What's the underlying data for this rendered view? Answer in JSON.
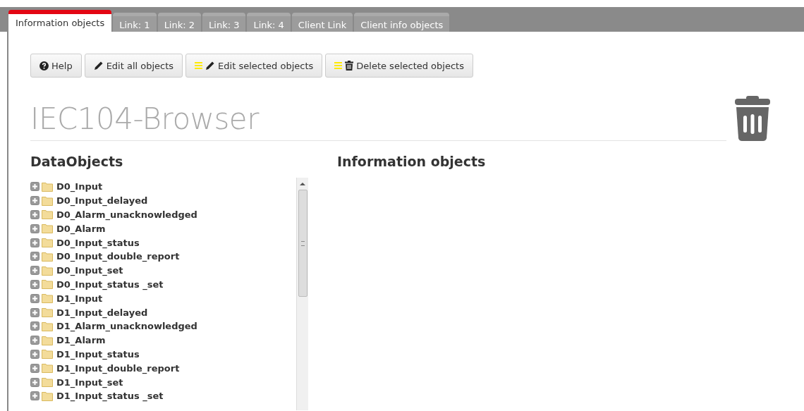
{
  "tabs": [
    {
      "label": "Information objects",
      "selected": true
    },
    {
      "label": "Link: 1",
      "selected": false
    },
    {
      "label": "Link: 2",
      "selected": false
    },
    {
      "label": "Link: 3",
      "selected": false
    },
    {
      "label": "Link: 4",
      "selected": false
    },
    {
      "label": "Client Link",
      "selected": false
    },
    {
      "label": "Client info objects",
      "selected": false
    }
  ],
  "toolbar": [
    {
      "label": "Help",
      "kind": "help"
    },
    {
      "label": "Edit all objects",
      "kind": "edit"
    },
    {
      "label": "Edit selected objects",
      "kind": "edit-selected"
    },
    {
      "label": "Delete selected objects",
      "kind": "delete-selected"
    }
  ],
  "page_title": "IEC104-Browser",
  "tree": {
    "heading": "DataObjects",
    "items": [
      {
        "label": "D0_Input",
        "expanded": false
      },
      {
        "label": "D0_Input_delayed",
        "expanded": false
      },
      {
        "label": "D0_Alarm_unacknowledged",
        "expanded": false
      },
      {
        "label": "D0_Alarm",
        "expanded": false
      },
      {
        "label": "D0_Input_status",
        "expanded": false
      },
      {
        "label": "D0_Input_double_report",
        "expanded": false
      },
      {
        "label": "D0_Input_set",
        "expanded": false
      },
      {
        "label": "D0_Input_status _set",
        "expanded": false
      },
      {
        "label": "D1_Input",
        "expanded": false
      },
      {
        "label": "D1_Input_delayed",
        "expanded": false
      },
      {
        "label": "D1_Alarm_unacknowledged",
        "expanded": false
      },
      {
        "label": "D1_Alarm",
        "expanded": false
      },
      {
        "label": "D1_Input_status",
        "expanded": false
      },
      {
        "label": "D1_Input_double_report",
        "expanded": false
      },
      {
        "label": "D1_Input_set",
        "expanded": false
      },
      {
        "label": "D1_Input_status _set",
        "expanded": false
      }
    ]
  },
  "info_panel": {
    "heading": "Information objects"
  }
}
